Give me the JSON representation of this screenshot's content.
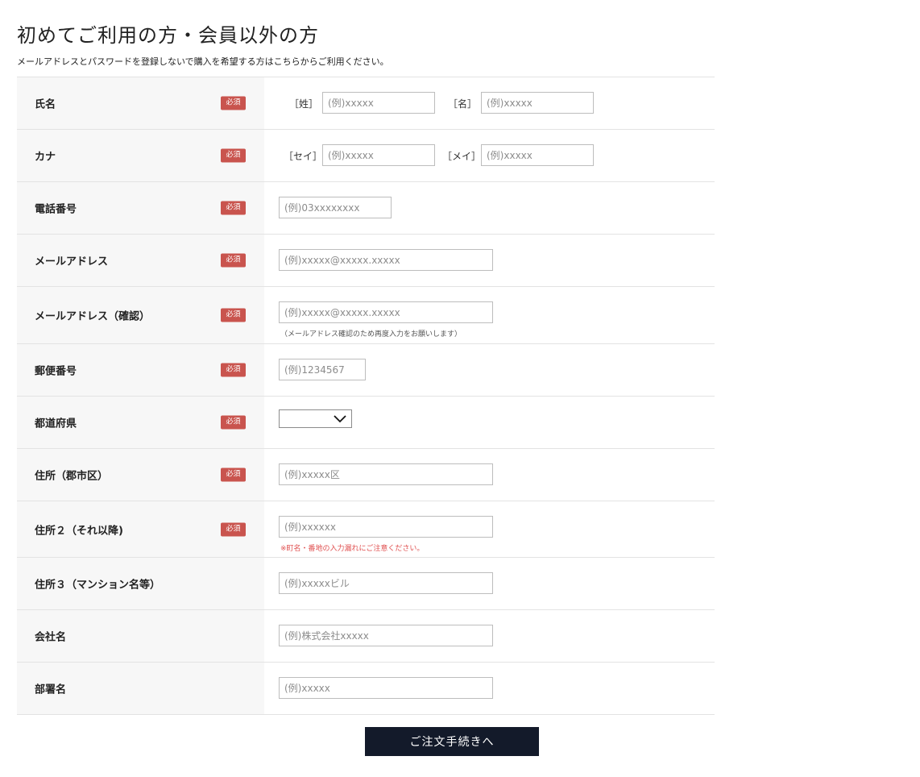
{
  "page_title": "初めてご利用の方・会員以外の方",
  "intro_text": "メールアドレスとパスワードを登録しないで購入を希望する方はこちらからご利用ください。",
  "required_badge": "必須",
  "rows": {
    "name": {
      "label": "氏名",
      "sub1": "［姓］",
      "sub2": "［名］",
      "ph1": "(例)xxxxx",
      "ph2": "(例)xxxxx"
    },
    "kana": {
      "label": "カナ",
      "sub1": "［セイ］",
      "sub2": "［メイ］",
      "ph1": "(例)xxxxx",
      "ph2": "(例)xxxxx"
    },
    "phone": {
      "label": "電話番号",
      "ph": "(例)03xxxxxxxx"
    },
    "email": {
      "label": "メールアドレス",
      "ph": "(例)xxxxx@xxxxx.xxxxx"
    },
    "email_confirm": {
      "label": "メールアドレス（確認）",
      "ph": "(例)xxxxx@xxxxx.xxxxx",
      "note": "（メールアドレス確認のため再度入力をお願いします）"
    },
    "postal": {
      "label": "郵便番号",
      "ph": "(例)1234567"
    },
    "prefecture": {
      "label": "都道府県",
      "value": ""
    },
    "address1": {
      "label": "住所（郡市区）",
      "ph": "(例)xxxxx区"
    },
    "address2": {
      "label": "住所２（それ以降)",
      "ph": "(例)xxxxxx",
      "note": "※町名・番地の入力漏れにご注意ください。"
    },
    "address3": {
      "label": "住所３（マンション名等）",
      "ph": "(例)xxxxxビル"
    },
    "company": {
      "label": "会社名",
      "ph": "(例)株式会社xxxxx"
    },
    "department": {
      "label": "部署名",
      "ph": "(例)xxxxx"
    }
  },
  "submit_label": "ご注文手続きへ",
  "colors": {
    "badge": "#c9544e",
    "button": "#131a2a",
    "note_red": "#e05050",
    "label_bg": "#f7f7f7"
  }
}
